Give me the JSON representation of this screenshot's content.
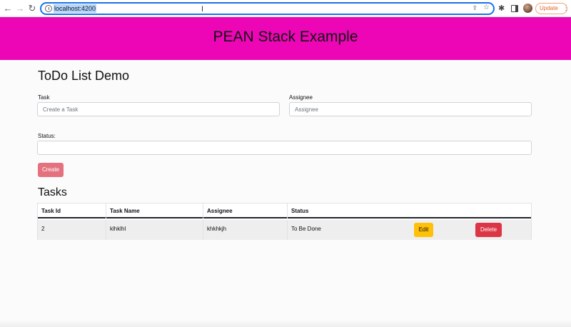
{
  "browser": {
    "url": "localhost:4200",
    "update_label": "Update"
  },
  "header": {
    "title": "PEAN Stack Example",
    "background": "#ec06b6"
  },
  "form": {
    "heading": "ToDo List Demo",
    "task_label": "Task",
    "task_placeholder": "Create a Task",
    "task_value": "",
    "assignee_label": "Assignee",
    "assignee_placeholder": "Assignee",
    "assignee_value": "",
    "status_label": "Status:",
    "status_value": "",
    "create_label": "Create"
  },
  "tasks": {
    "heading": "Tasks",
    "columns": [
      "Task Id",
      "Task Name",
      "Assignee",
      "Status"
    ],
    "rows": [
      {
        "id": "2",
        "name": "klhklhl",
        "assignee": "khkhkjh",
        "status": "To Be Done",
        "edit_label": "Edit",
        "delete_label": "Delete"
      }
    ]
  },
  "colors": {
    "accent_pink": "#ec06b6",
    "create_button": "#e4727e",
    "edit_button": "#ffc107",
    "delete_button": "#dc3545"
  }
}
